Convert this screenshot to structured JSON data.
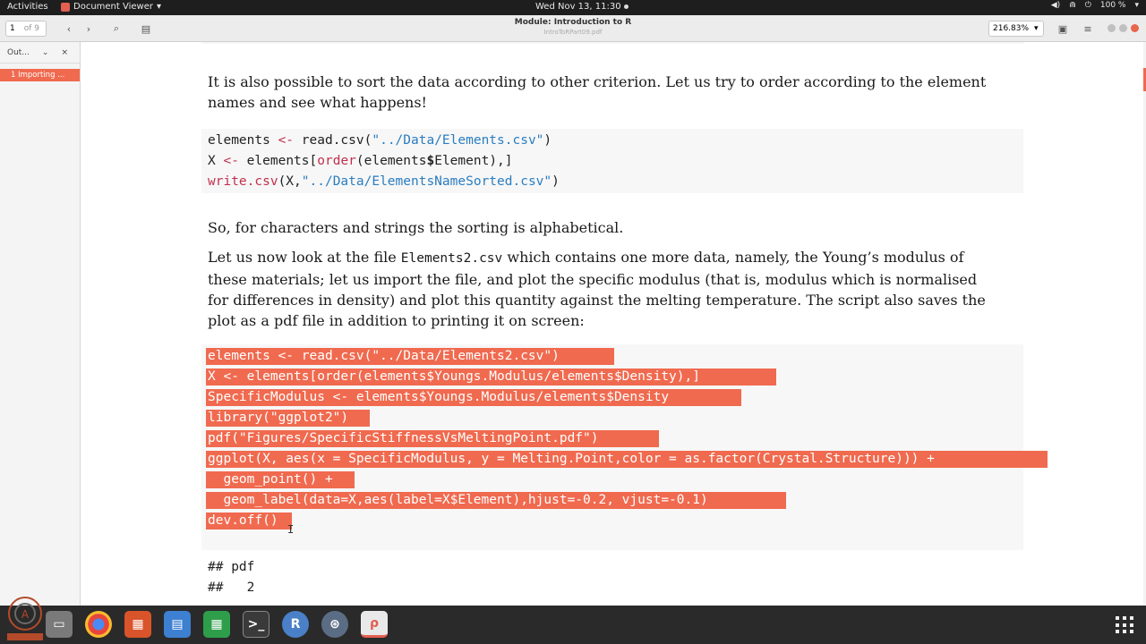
{
  "topbar": {
    "activities": "Activities",
    "app_name": "Document Viewer",
    "clock": "Wed Nov 13, 11:30",
    "battery": "100 %"
  },
  "headerbar": {
    "page_current": "1",
    "page_total": "of 9",
    "title": "Module: Introduction to R",
    "subtitle": "IntroToRPart09.pdf",
    "zoom": "216.83%"
  },
  "sidebar": {
    "dropdown_label": "Out...",
    "items": [
      {
        "label": "1 Importing ..."
      }
    ]
  },
  "document": {
    "para1_line1": "It is also possible to sort the data according to other criterion. Let us try to order according to the element",
    "para1_line2": "names and see what happens!",
    "code1": {
      "l1_a": "elements ",
      "l1_b": "<-",
      "l1_c": " read.csv(",
      "l1_d": "\"../Data/Elements.csv\"",
      "l1_e": ")",
      "l2_a": "X ",
      "l2_b": "<-",
      "l2_c": " elements[",
      "l2_d": "order",
      "l2_e": "(elements",
      "l2_f": "$",
      "l2_g": "Element),]",
      "l3_a": "write.csv",
      "l3_b": "(X,",
      "l3_c": "\"../Data/ElementsNameSorted.csv\"",
      "l3_d": ")"
    },
    "para2": "So, for characters and strings the sorting is alphabetical.",
    "para3_line1_a": "Let us now look at the file ",
    "para3_line1_code": "Elements2.csv",
    "para3_line1_b": " which contains one more data, namely, the Young’s modulus of",
    "para3_line2": "these materials; let us import the file, and plot the specific modulus (that is, modulus which is normalised",
    "para3_line3": "for differences in density) and plot this quantity against the melting temperature. The script also saves the",
    "para3_line4": "plot as a pdf file in addition to printing it on screen:",
    "code2": [
      "elements <- read.csv(\"../Data/Elements2.csv\")",
      "X <- elements[order(elements$Youngs.Modulus/elements$Density),]",
      "SpecificModulus <- elements$Youngs.Modulus/elements$Density",
      "library(\"ggplot2\")",
      "pdf(\"Figures/SpecificStiffnessVsMeltingPoint.pdf\")",
      "ggplot(X, aes(x = SpecificModulus, y = Melting.Point,color = as.factor(Crystal.Structure))) +",
      "  geom_point() +",
      "  geom_label(data=X,aes(label=X$Element),hjust=-0.2, vjust=-0.1)",
      "dev.off()"
    ],
    "output": [
      "## pdf",
      "##   2"
    ]
  },
  "dock": {
    "r_label": "R"
  },
  "colors": {
    "highlight": "#f06a4f",
    "keyword": "#c0304d",
    "string": "#2a7dc0"
  }
}
